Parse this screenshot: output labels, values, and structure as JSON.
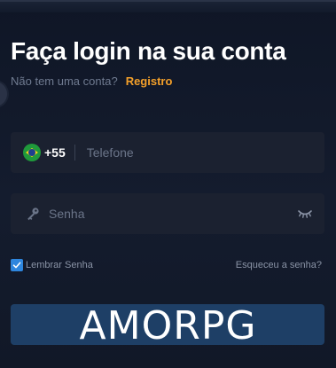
{
  "login": {
    "title": "Faça login na sua conta",
    "signup_prompt": "Não tem uma conta?",
    "signup_link": "Registro",
    "phone": {
      "country_flag": "brazil-flag-icon",
      "country_code": "+55",
      "placeholder": "Telefone",
      "value": ""
    },
    "password": {
      "key_icon": "key-icon",
      "placeholder": "Senha",
      "value": "",
      "visibility_icon": "eye-closed-icon"
    },
    "remember_label": "Lembrar Senha",
    "remember_checked": true,
    "forgot_link": "Esqueceu a senha?",
    "submit_label": ""
  },
  "watermark": {
    "text": "AMORPG"
  },
  "colors": {
    "background": "#121a2b",
    "field_background": "#1b2130",
    "accent_link": "#f4a02a",
    "checkbox": "#2e86de",
    "button_background": "#1e3f66",
    "muted_text": "#6f7a90"
  }
}
